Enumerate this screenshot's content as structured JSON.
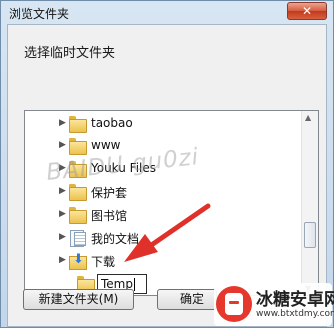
{
  "window": {
    "title": "浏览文件夹",
    "close_glyph": "✕"
  },
  "dialog": {
    "prompt": "选择临时文件夹"
  },
  "tree": {
    "items": [
      {
        "label": "taobao",
        "icon": "folder-icon"
      },
      {
        "label": "www",
        "icon": "folder-icon"
      },
      {
        "label": "Youku Files",
        "icon": "folder-icon"
      },
      {
        "label": "保护套",
        "icon": "folder-icon"
      },
      {
        "label": "图书馆",
        "icon": "folder-icon"
      },
      {
        "label": "我的文档",
        "icon": "documents-icon"
      },
      {
        "label": "下载",
        "icon": "download-folder-icon"
      }
    ],
    "editing": {
      "value": "Temp",
      "icon": "folder-icon"
    }
  },
  "buttons": {
    "new_folder": "新建文件夹(M)",
    "ok": "确定"
  },
  "watermark": "BAIDU  gu0zi",
  "logo": {
    "name": "冰糖安卓网",
    "url": "www.btxtdmy.com",
    "color": "#e5372b"
  },
  "colors": {
    "accent_arrow": "#e0302a",
    "titlebar": "#c9dbee",
    "close_button": "#d0482b"
  }
}
